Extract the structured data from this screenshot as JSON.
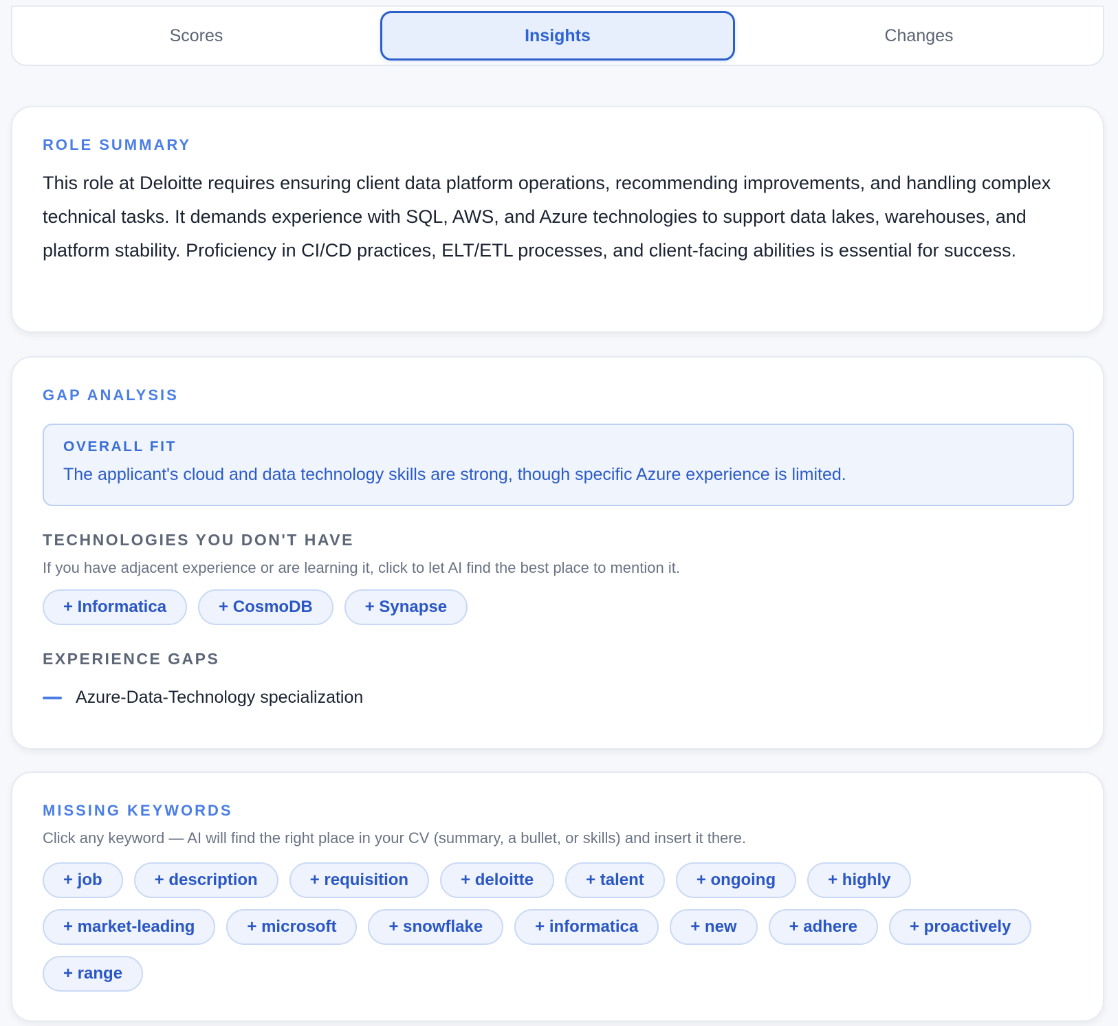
{
  "tabs": [
    {
      "label": "Scores",
      "active": false
    },
    {
      "label": "Insights",
      "active": true
    },
    {
      "label": "Changes",
      "active": false
    }
  ],
  "role_summary": {
    "title": "ROLE SUMMARY",
    "text": "This role at Deloitte requires ensuring client data platform operations, recommending improvements, and handling complex technical tasks. It demands experience with SQL, AWS, and Azure technologies to support data lakes, warehouses, and platform stability. Proficiency in CI/CD practices, ELT/ETL processes, and client-facing abilities is essential for success."
  },
  "gap_analysis": {
    "title": "GAP ANALYSIS",
    "overall_fit": {
      "label": "OVERALL FIT",
      "text": "The applicant's cloud and data technology skills are strong, though specific Azure experience is limited."
    },
    "technologies": {
      "title": "TECHNOLOGIES YOU DON'T HAVE",
      "description": "If you have adjacent experience or are learning it, click to let AI find the best place to mention it.",
      "items": [
        "+ Informatica",
        "+ CosmoDB",
        "+ Synapse"
      ]
    },
    "experience_gaps": {
      "title": "EXPERIENCE GAPS",
      "items": [
        "Azure-Data-Technology specialization"
      ]
    }
  },
  "missing_keywords": {
    "title": "MISSING KEYWORDS",
    "description": "Click any keyword — AI will find the right place in your CV (summary, a bullet, or skills) and insert it there.",
    "items": [
      "+ job",
      "+ description",
      "+ requisition",
      "+ deloitte",
      "+ talent",
      "+ ongoing",
      "+ highly",
      "+ market-leading",
      "+ microsoft",
      "+ snowflake",
      "+ informatica",
      "+ new",
      "+ adhere",
      "+ proactively",
      "+ range"
    ]
  }
}
